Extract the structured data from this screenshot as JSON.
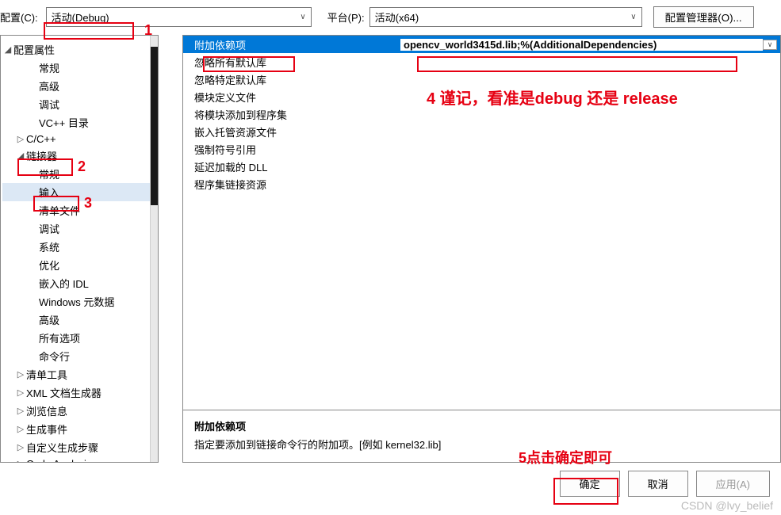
{
  "topbar": {
    "config_label": "配置(C):",
    "config_value": "活动(Debug)",
    "platform_label": "平台(P):",
    "platform_value": "活动(x64)",
    "config_manager_btn": "配置管理器(O)..."
  },
  "tree": {
    "root": "配置属性",
    "items": [
      {
        "label": "常规",
        "indent": 2,
        "exp": ""
      },
      {
        "label": "高级",
        "indent": 2,
        "exp": ""
      },
      {
        "label": "调试",
        "indent": 2,
        "exp": ""
      },
      {
        "label": "VC++ 目录",
        "indent": 2,
        "exp": ""
      },
      {
        "label": "C/C++",
        "indent": 1,
        "exp": "▷"
      },
      {
        "label": "链接器",
        "indent": 1,
        "exp": "◢"
      },
      {
        "label": "常规",
        "indent": 2,
        "exp": ""
      },
      {
        "label": "输入",
        "indent": 2,
        "exp": "",
        "selected": true
      },
      {
        "label": "清单文件",
        "indent": 2,
        "exp": ""
      },
      {
        "label": "调试",
        "indent": 2,
        "exp": ""
      },
      {
        "label": "系统",
        "indent": 2,
        "exp": ""
      },
      {
        "label": "优化",
        "indent": 2,
        "exp": ""
      },
      {
        "label": "嵌入的 IDL",
        "indent": 2,
        "exp": ""
      },
      {
        "label": "Windows 元数据",
        "indent": 2,
        "exp": ""
      },
      {
        "label": "高级",
        "indent": 2,
        "exp": ""
      },
      {
        "label": "所有选项",
        "indent": 2,
        "exp": ""
      },
      {
        "label": "命令行",
        "indent": 2,
        "exp": ""
      },
      {
        "label": "清单工具",
        "indent": 1,
        "exp": "▷"
      },
      {
        "label": "XML 文档生成器",
        "indent": 1,
        "exp": "▷"
      },
      {
        "label": "浏览信息",
        "indent": 1,
        "exp": "▷"
      },
      {
        "label": "生成事件",
        "indent": 1,
        "exp": "▷"
      },
      {
        "label": "自定义生成步骤",
        "indent": 1,
        "exp": "▷"
      },
      {
        "label": "Code Analysis",
        "indent": 1,
        "exp": "▷"
      }
    ]
  },
  "props": {
    "rows": [
      {
        "label": "附加依赖项",
        "value": "opencv_world3415d.lib;%(AdditionalDependencies)",
        "selected": true,
        "has_dd": true
      },
      {
        "label": "忽略所有默认库",
        "value": ""
      },
      {
        "label": "忽略特定默认库",
        "value": ""
      },
      {
        "label": "模块定义文件",
        "value": ""
      },
      {
        "label": "将模块添加到程序集",
        "value": ""
      },
      {
        "label": "嵌入托管资源文件",
        "value": ""
      },
      {
        "label": "强制符号引用",
        "value": ""
      },
      {
        "label": "延迟加载的 DLL",
        "value": ""
      },
      {
        "label": "程序集链接资源",
        "value": ""
      }
    ]
  },
  "desc": {
    "title": "附加依赖项",
    "text": "指定要添加到链接命令行的附加项。[例如 kernel32.lib]"
  },
  "buttons": {
    "ok": "确定",
    "cancel": "取消",
    "apply": "应用(A)"
  },
  "annotations": {
    "a1": "1",
    "a2": "2",
    "a3": "3",
    "a4": "4 谨记，看准是debug 还是 release",
    "a5": "5点击确定即可"
  },
  "watermark": "CSDN @lvy_belief"
}
